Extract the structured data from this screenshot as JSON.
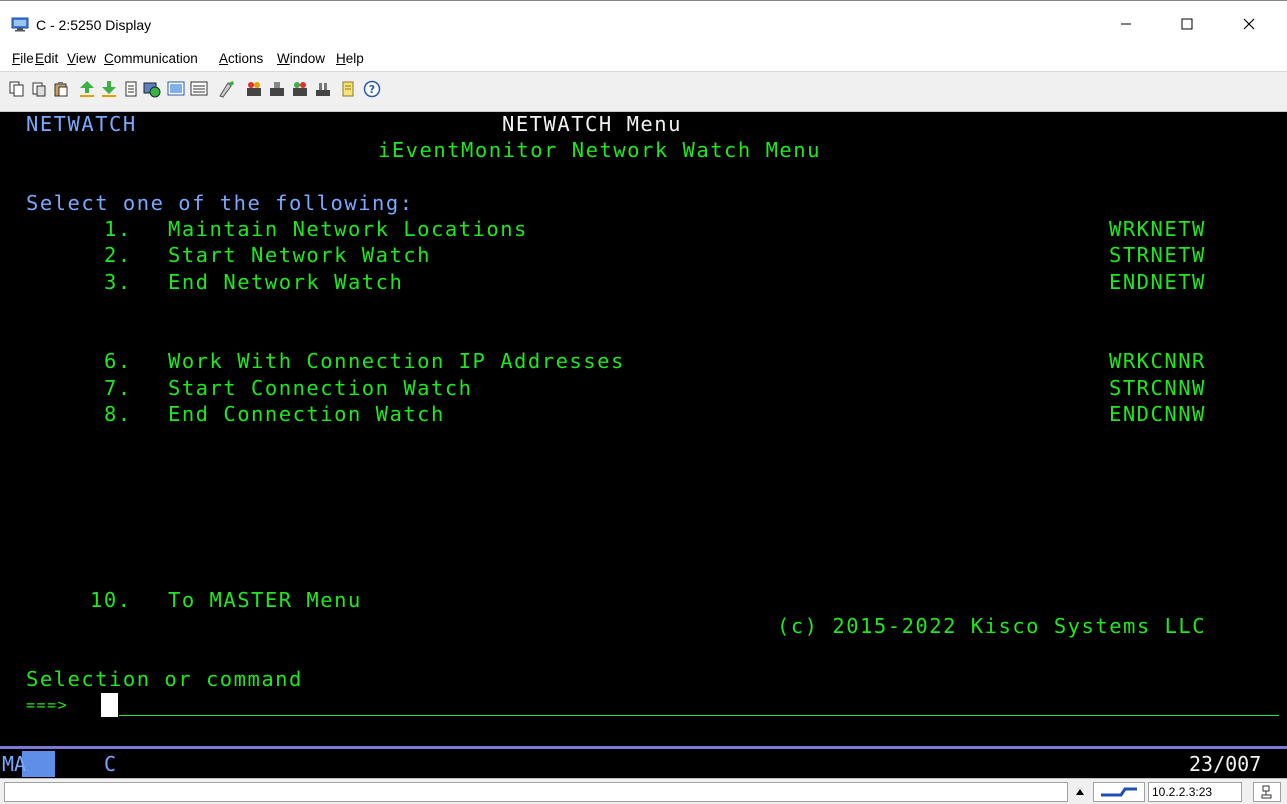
{
  "window": {
    "title": "C - 2:5250 Display",
    "icon": "monitor-icon"
  },
  "menubar": {
    "items": [
      "File",
      "Edit",
      "View",
      "Communication",
      "Actions",
      "Window",
      "Help"
    ]
  },
  "toolbar": {
    "icons": [
      "copy-icon",
      "copy-append-icon",
      "paste-icon",
      "send-file-icon",
      "receive-file-icon",
      "print-screen-icon",
      "macro-icon",
      "record-macro-icon",
      "play-macro-icon",
      "customize-keyboard-icon",
      "data-transfer-icon",
      "receive-data-icon",
      "send-data-icon",
      "run-icon",
      "notes-icon",
      "help-icon"
    ]
  },
  "screen": {
    "system_label": "NETWATCH",
    "menu_title": "NETWATCH Menu",
    "menu_subtitle": "iEventMonitor Network Watch Menu",
    "prompt": "Select one of the following:",
    "options": [
      {
        "num": "1.",
        "label": "Maintain Network Locations",
        "command": "WRKNETW"
      },
      {
        "num": "2.",
        "label": "Start Network Watch",
        "command": "STRNETW"
      },
      {
        "num": "3.",
        "label": "End Network Watch",
        "command": "ENDNETW"
      },
      {
        "num": "6.",
        "label": "Work With Connection IP Addresses",
        "command": "WRKCNNR"
      },
      {
        "num": "7.",
        "label": "Start Connection Watch",
        "command": "STRCNNW"
      },
      {
        "num": "8.",
        "label": "End Connection Watch",
        "command": "ENDCNNW"
      },
      {
        "num": "10.",
        "label": "To MASTER Menu",
        "command": ""
      }
    ],
    "copyright": "(c) 2015-2022 Kisco Systems LLC",
    "command_label": "Selection or command",
    "command_arrow": "===>",
    "command_value": ""
  },
  "status": {
    "mode": "MA",
    "session": "C",
    "cursor_position": "23/007"
  },
  "bottom_bar": {
    "ip_address": "10.2.2.3:23"
  },
  "colors": {
    "terminal_green": "#1ee81e",
    "terminal_blue": "#7aa7ff",
    "terminal_white": "#f2f2f2",
    "terminal_background": "#000000"
  }
}
